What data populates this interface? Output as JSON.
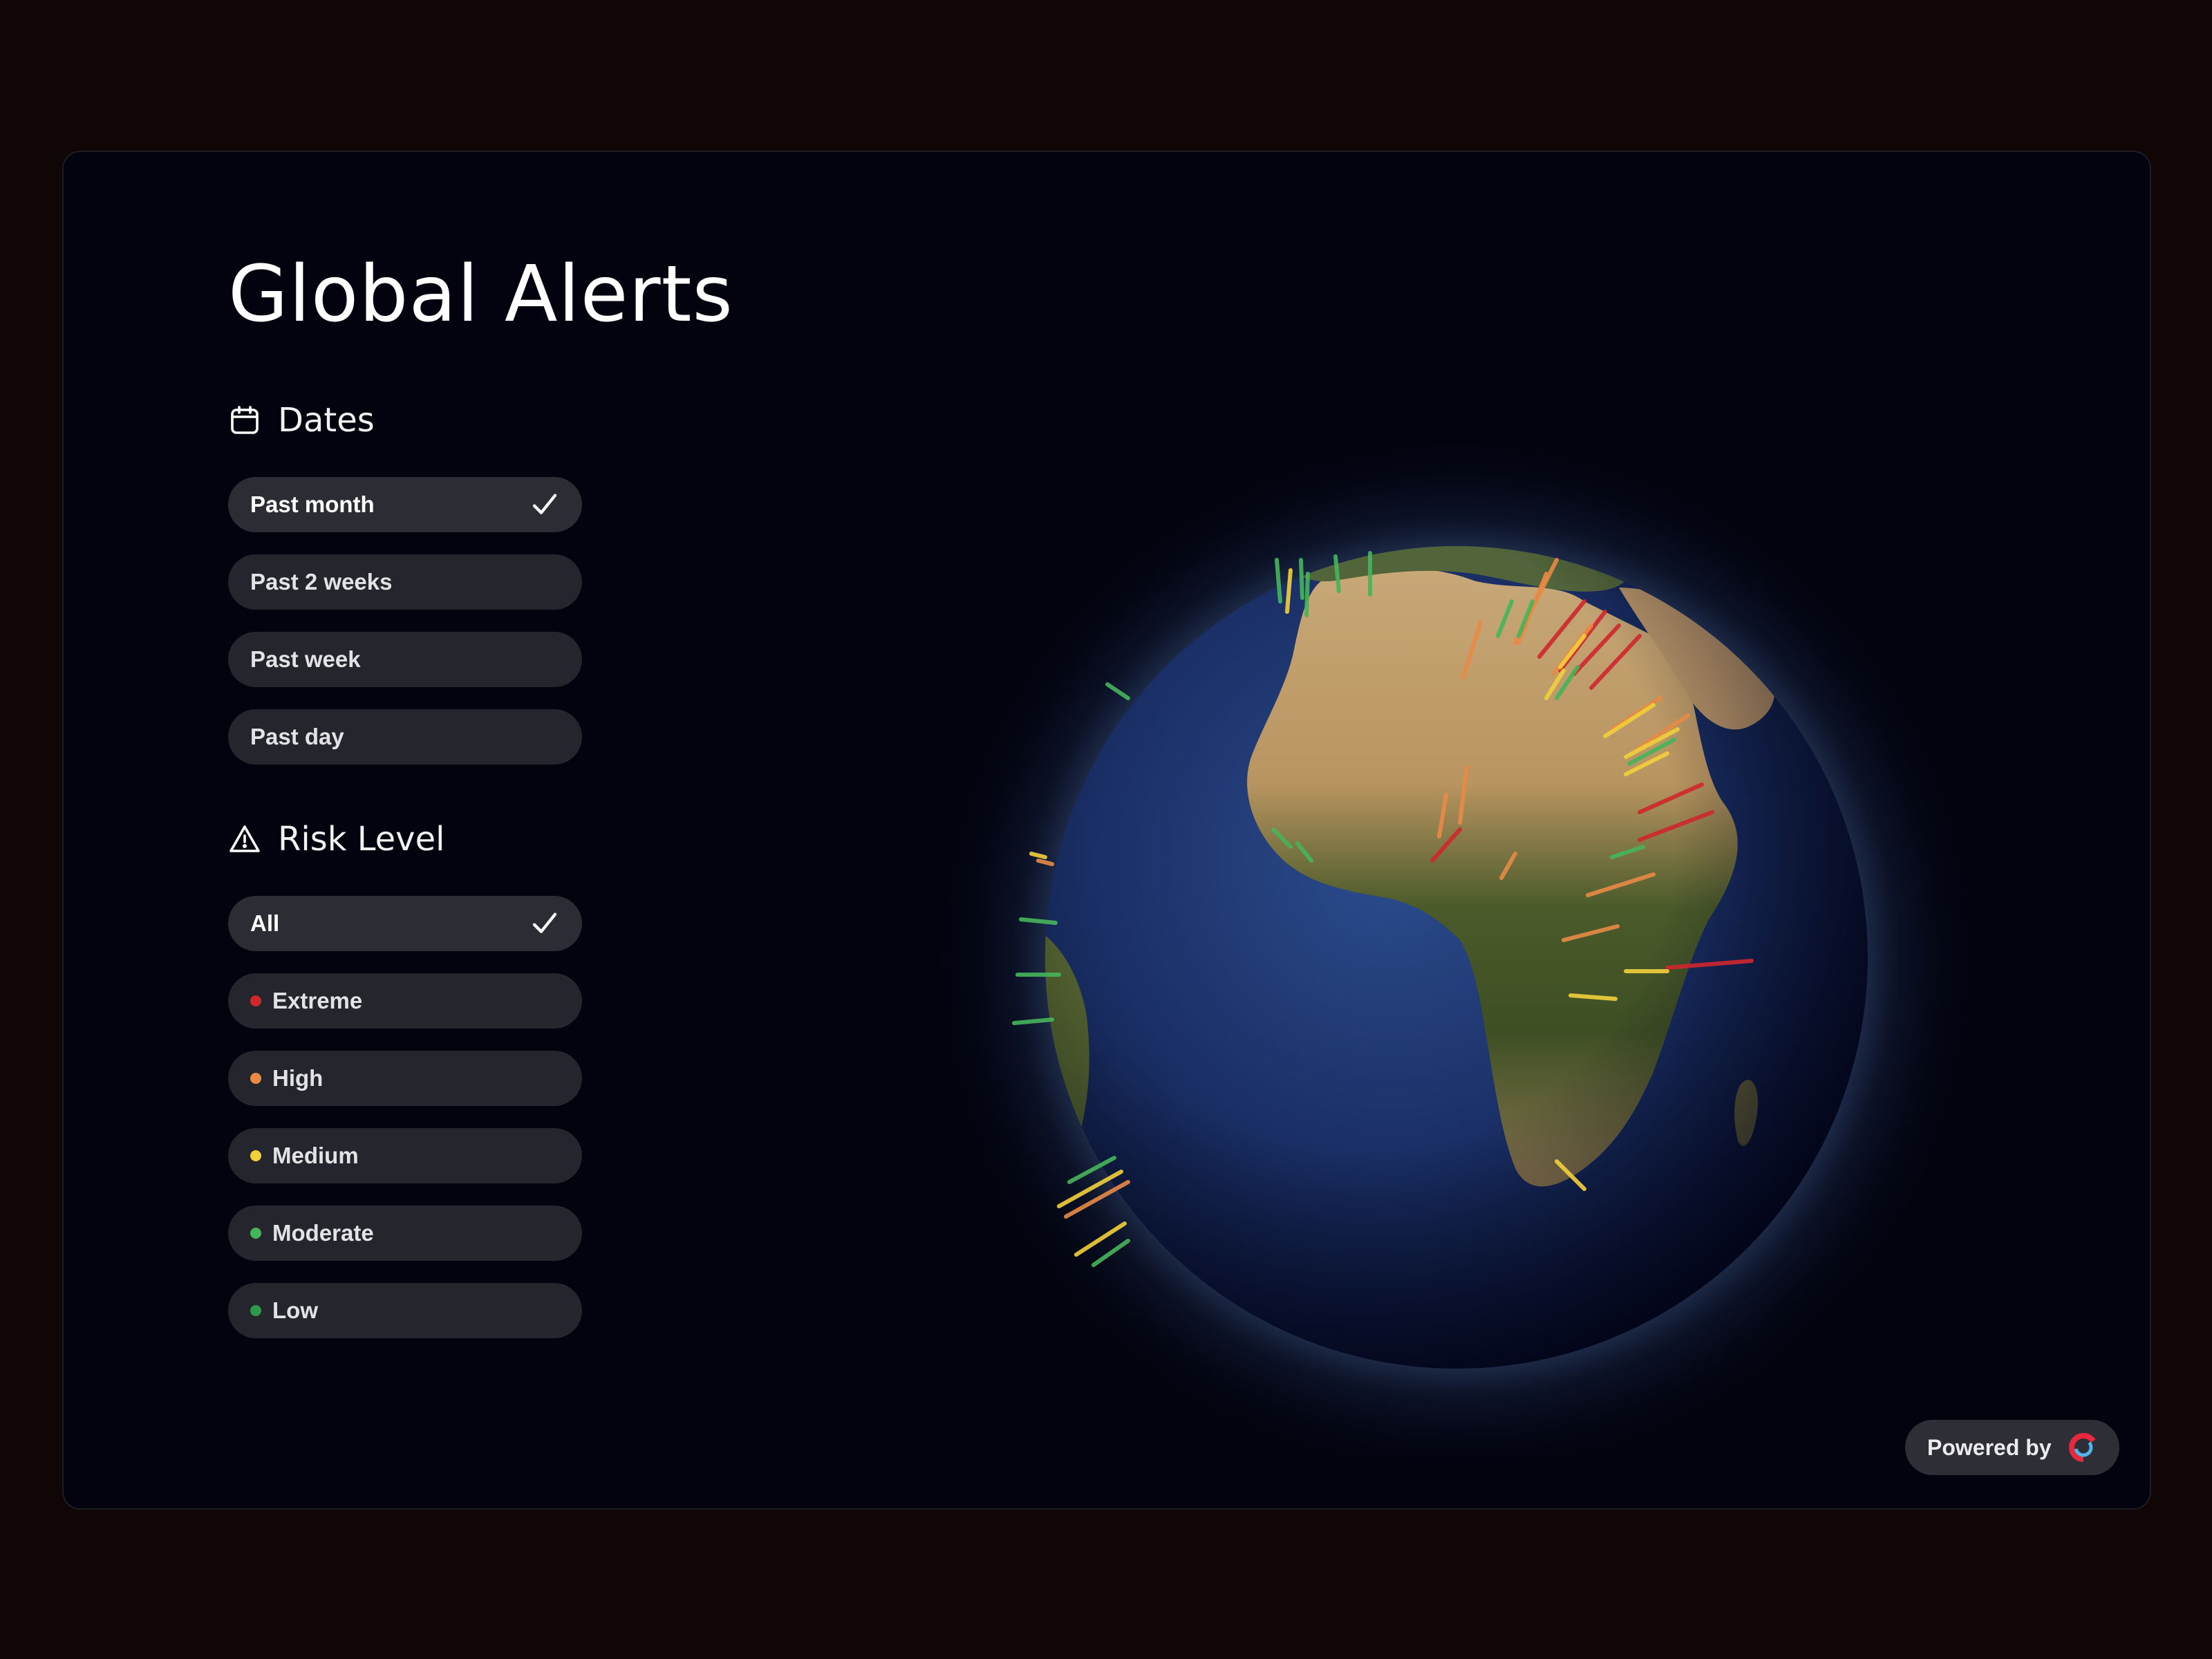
{
  "page": {
    "title": "Global Alerts"
  },
  "filters": {
    "dates": {
      "heading": "Dates",
      "icon": "calendar-icon",
      "options": [
        {
          "label": "Past month",
          "selected": true
        },
        {
          "label": "Past 2 weeks",
          "selected": false
        },
        {
          "label": "Past week",
          "selected": false
        },
        {
          "label": "Past day",
          "selected": false
        }
      ]
    },
    "risk_level": {
      "heading": "Risk Level",
      "icon": "warning-icon",
      "options": [
        {
          "label": "All",
          "selected": true,
          "color": null
        },
        {
          "label": "Extreme",
          "selected": false,
          "color": "#d0272d"
        },
        {
          "label": "High",
          "selected": false,
          "color": "#e98a45"
        },
        {
          "label": "Medium",
          "selected": false,
          "color": "#f2d03a"
        },
        {
          "label": "Moderate",
          "selected": false,
          "color": "#46b55a"
        },
        {
          "label": "Low",
          "selected": false,
          "color": "#2b9a4a"
        }
      ]
    }
  },
  "globe": {
    "view": "Africa, Europe and Middle East facing",
    "alert_markers_icon": "alert-spike-icon"
  },
  "footer": {
    "powered_by": "Powered by",
    "logo_icon": "ring-logo-icon"
  },
  "colors": {
    "background": "#110606",
    "panel": "#02030f",
    "pill": "#25262d",
    "extreme": "#d0272d",
    "high": "#e98a45",
    "medium": "#f2d03a",
    "moderate": "#46b55a",
    "low": "#2b9a4a"
  }
}
